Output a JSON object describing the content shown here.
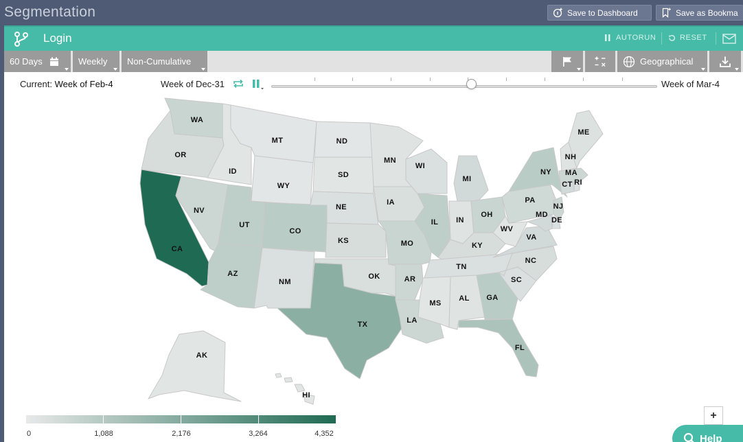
{
  "app": {
    "title": "Segmentation",
    "save_dashboard_label": "Save to Dashboard",
    "save_bookmark_label": "Save as Bookma"
  },
  "panel": {
    "title": "Login",
    "autorun_label": "AUTORUN",
    "reset_label": "RESET"
  },
  "toolbar": {
    "range_label": "60 Days",
    "interval_label": "Weekly",
    "mode_label": "Non-Cumulative",
    "view_label": "Geographical"
  },
  "timeline": {
    "current_prefix": "Current:",
    "current_value": "Week of Feb-4",
    "start_label": "Week of Dec-31",
    "end_label": "Week of Mar-4",
    "position": 0.52
  },
  "map": {
    "states": [
      {
        "abbr": "WA",
        "value": 700
      },
      {
        "abbr": "OR",
        "value": 400
      },
      {
        "abbr": "CA",
        "value": 4352
      },
      {
        "abbr": "ID",
        "value": 150
      },
      {
        "abbr": "NV",
        "value": 600
      },
      {
        "abbr": "MT",
        "value": 100
      },
      {
        "abbr": "WY",
        "value": 100
      },
      {
        "abbr": "UT",
        "value": 900
      },
      {
        "abbr": "AZ",
        "value": 900
      },
      {
        "abbr": "CO",
        "value": 1000
      },
      {
        "abbr": "NM",
        "value": 300
      },
      {
        "abbr": "ND",
        "value": 100
      },
      {
        "abbr": "SD",
        "value": 150
      },
      {
        "abbr": "NE",
        "value": 300
      },
      {
        "abbr": "KS",
        "value": 400
      },
      {
        "abbr": "OK",
        "value": 350
      },
      {
        "abbr": "TX",
        "value": 2000
      },
      {
        "abbr": "MN",
        "value": 200
      },
      {
        "abbr": "IA",
        "value": 350
      },
      {
        "abbr": "MO",
        "value": 700
      },
      {
        "abbr": "AR",
        "value": 600
      },
      {
        "abbr": "LA",
        "value": 600
      },
      {
        "abbr": "WI",
        "value": 300
      },
      {
        "abbr": "IL",
        "value": 900
      },
      {
        "abbr": "MI",
        "value": 500
      },
      {
        "abbr": "IN",
        "value": 200
      },
      {
        "abbr": "OH",
        "value": 700
      },
      {
        "abbr": "KY",
        "value": 400
      },
      {
        "abbr": "TN",
        "value": 300
      },
      {
        "abbr": "MS",
        "value": 150
      },
      {
        "abbr": "AL",
        "value": 200
      },
      {
        "abbr": "GA",
        "value": 1000
      },
      {
        "abbr": "FL",
        "value": 1300
      },
      {
        "abbr": "SC",
        "value": 300
      },
      {
        "abbr": "NC",
        "value": 400
      },
      {
        "abbr": "VA",
        "value": 500
      },
      {
        "abbr": "WV",
        "value": 150
      },
      {
        "abbr": "PA",
        "value": 550
      },
      {
        "abbr": "NY",
        "value": 1000
      },
      {
        "abbr": "NJ",
        "value": 600
      },
      {
        "abbr": "DE",
        "value": 300
      },
      {
        "abbr": "MD",
        "value": 500
      },
      {
        "abbr": "CT",
        "value": 500
      },
      {
        "abbr": "RI",
        "value": 300
      },
      {
        "abbr": "MA",
        "value": 600
      },
      {
        "abbr": "NH",
        "value": 200
      },
      {
        "abbr": "ME",
        "value": 250
      },
      {
        "abbr": "AK",
        "value": 150
      },
      {
        "abbr": "HI",
        "value": 150
      }
    ],
    "legend": {
      "ticks": [
        "0",
        "1,088",
        "2,176",
        "3,264",
        "4,352"
      ],
      "max": 4352,
      "color_low": "#e8e9e9",
      "color_high": "#1f6a52"
    }
  },
  "help": {
    "label": "Help"
  },
  "colors": {
    "accent": "#46bba7",
    "topbar": "#4f5b74",
    "toolbar_button": "#9b9b9b"
  }
}
